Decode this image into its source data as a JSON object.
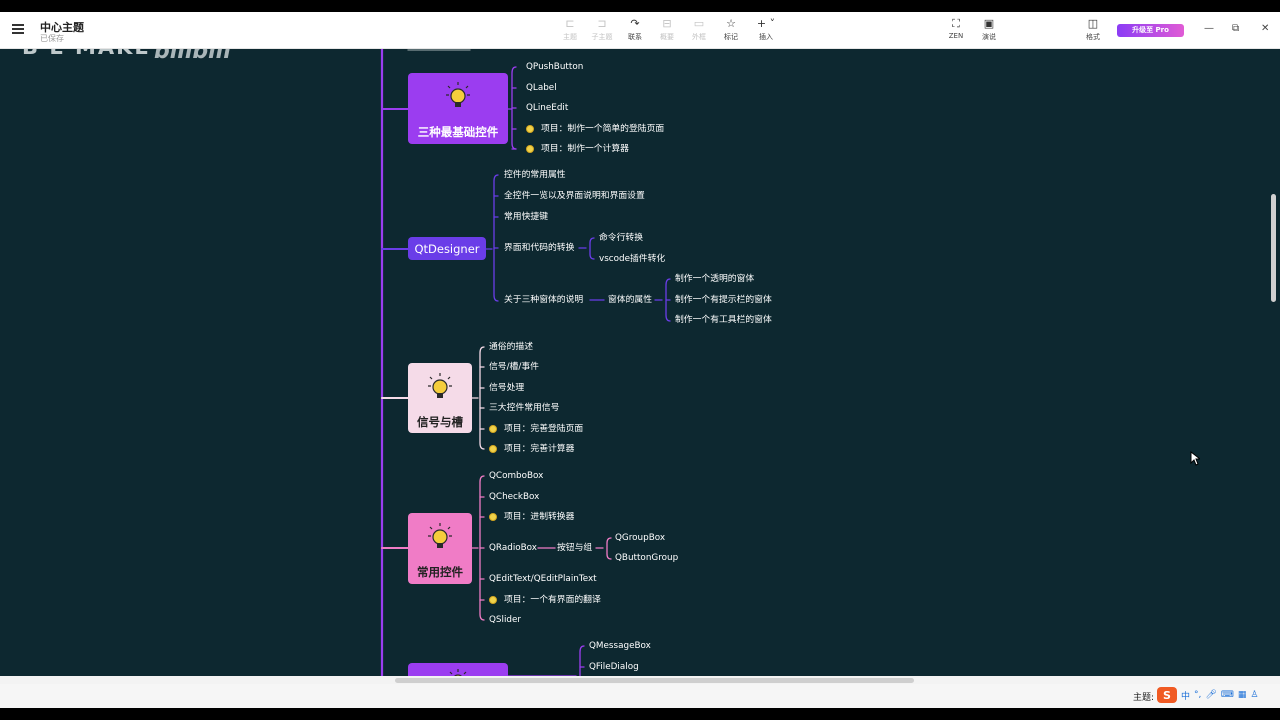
{
  "titlebar": {
    "title": "中心主题",
    "subtitle": "已保存",
    "toolbar": [
      {
        "icon": "subtopic-icon",
        "label": "主题",
        "enabled": false
      },
      {
        "icon": "sibling-topic-icon",
        "label": "子主题",
        "enabled": false
      },
      {
        "icon": "relationship-icon",
        "label": "联系",
        "enabled": true
      },
      {
        "icon": "summary-icon",
        "label": "概要",
        "enabled": false
      },
      {
        "icon": "boundary-icon",
        "label": "外框",
        "enabled": false
      },
      {
        "icon": "marker-star-icon",
        "label": "标记",
        "enabled": true
      },
      {
        "icon": "insert-plus-icon",
        "label": "插入",
        "enabled": true
      }
    ],
    "zen_label": "ZEN",
    "present_label": "演说",
    "format_label": "格式",
    "upgrade_label": "升级至 Pro"
  },
  "watermark": {
    "text": "B E MAKE",
    "logo": "bilibili"
  },
  "mindmap": {
    "colors": {
      "spine": "#9b3df0",
      "basic": "#9b3df0",
      "designer": "#6a3de8",
      "signals": "#f5dbe8",
      "common": "#f07cc6",
      "dialog": "#9b3df0",
      "canvas": "#0d2830"
    },
    "topics": [
      {
        "title": "三种最基础控件",
        "children": [
          "QPushButton",
          "QLabel",
          "QLineEdit",
          "项目：制作一个简单的登陆页面",
          "项目：制作一个计算器"
        ]
      },
      {
        "title": "QtDesigner",
        "children": [
          "控件的常用属性",
          "全控件一览以及界面说明和界面设置",
          "常用快捷键",
          "界面和代码的转换",
          "关于三种窗体的说明"
        ],
        "conversion": [
          "命令行转换",
          "vscode插件转化"
        ],
        "window_attr": "窗体的属性",
        "window_children": [
          "制作一个透明的窗体",
          "制作一个有提示栏的窗体",
          "制作一个有工具栏的窗体"
        ]
      },
      {
        "title": "信号与槽",
        "children": [
          "通俗的描述",
          "信号/槽/事件",
          "信号处理",
          "三大控件常用信号",
          "项目：完善登陆页面",
          "项目：完善计算器"
        ]
      },
      {
        "title": "常用控件",
        "children": [
          "QComboBox",
          "QCheckBox",
          "项目：进制转换器",
          "QRadioBox",
          "QEditText/QEditPlainText",
          "项目：一个有界面的翻译",
          "QSlider"
        ],
        "radio_child": "按钮与组",
        "group_children": [
          "QGroupBox",
          "QButtonGroup"
        ]
      },
      {
        "title": "",
        "children": [
          "QMessageBox",
          "QFileDialog"
        ]
      }
    ]
  },
  "statusbar": {
    "theme_label": "主题:",
    "tray": [
      "中",
      "°,",
      "mic",
      "kbd",
      "grid",
      "shirt"
    ]
  }
}
